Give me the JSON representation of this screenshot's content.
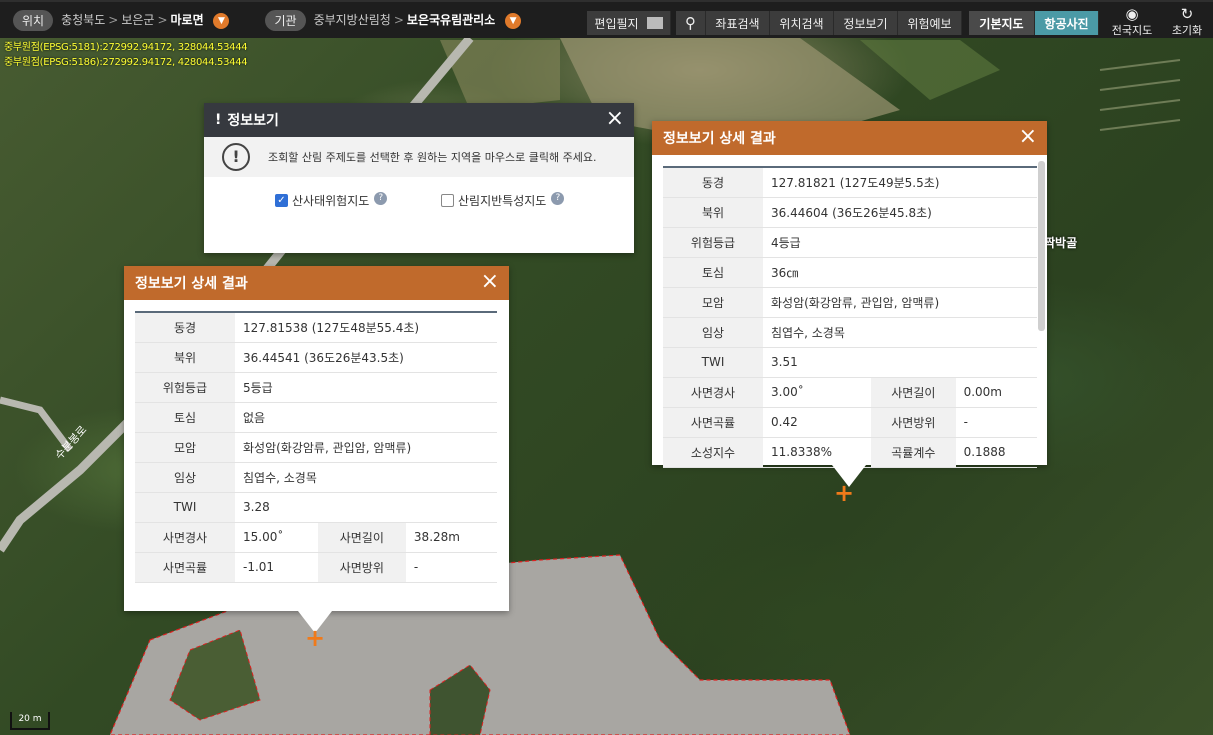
{
  "topbar": {
    "location_label": "위치",
    "location_path": [
      "충청북도",
      "보은군"
    ],
    "location_current": "마로면",
    "agency_label": "기관",
    "agency_path": [
      "중부지방산림청"
    ],
    "agency_current": "보은국유림관리소",
    "edit_parcel": "편입필지",
    "coord_search": "좌표검색",
    "pos_search": "위치검색",
    "info_view": "정보보기",
    "risk_forecast": "위험예보",
    "base_map": "기본지도",
    "aerial": "항공사진",
    "nation_map": "전국지도",
    "reset": "초기화"
  },
  "map": {
    "coord_line1": "중부원점(EPSG:5181):272992.94172, 328044.53444",
    "coord_line2": "중부원점(EPSG:5186):272992.94172, 428044.53444",
    "road_label": "수분봉로",
    "place_label": "짝박골",
    "scale": "20 m"
  },
  "info_panel": {
    "title": "정보보기",
    "message": "조회할 산림 주제도를 선택한 후 원하는 지역을 마우스로 클릭해 주세요.",
    "opt1": "산사태위험지도",
    "opt2": "산림지반특성지도",
    "opt1_checked": true,
    "opt2_checked": false
  },
  "detail_left": {
    "title": "정보보기 상세 결과",
    "rows": [
      {
        "k": "동경",
        "v": "127.81538 (127도48분55.4초)"
      },
      {
        "k": "북위",
        "v": "36.44541 (36도26분43.5초)"
      },
      {
        "k": "위험등급",
        "v": "5등급"
      },
      {
        "k": "토심",
        "v": "없음"
      },
      {
        "k": "모암",
        "v": "화성암(화강암류, 관입암, 암맥류)"
      },
      {
        "k": "임상",
        "v": "침엽수, 소경목"
      },
      {
        "k": "TWI",
        "v": "3.28"
      }
    ],
    "pairs": [
      {
        "k1": "사면경사",
        "v1": "15.00˚",
        "k2": "사면길이",
        "v2": "38.28m"
      },
      {
        "k1": "사면곡률",
        "v1": "-1.01",
        "k2": "사면방위",
        "v2": "-"
      }
    ]
  },
  "detail_right": {
    "title": "정보보기 상세 결과",
    "rows": [
      {
        "k": "동경",
        "v": "127.81821 (127도49분5.5초)"
      },
      {
        "k": "북위",
        "v": "36.44604 (36도26분45.8초)"
      },
      {
        "k": "위험등급",
        "v": "4등급"
      },
      {
        "k": "토심",
        "v": "36㎝"
      },
      {
        "k": "모암",
        "v": "화성암(화강암류, 관입암, 암맥류)"
      },
      {
        "k": "임상",
        "v": "침엽수, 소경목"
      },
      {
        "k": "TWI",
        "v": "3.51"
      }
    ],
    "pairs": [
      {
        "k1": "사면경사",
        "v1": "3.00˚",
        "k2": "사면길이",
        "v2": "0.00m"
      },
      {
        "k1": "사면곡률",
        "v1": "0.42",
        "k2": "사면방위",
        "v2": "-"
      },
      {
        "k1": "소성지수",
        "v1": "11.8338%",
        "k2": "곡률계수",
        "v2": "0.1888"
      }
    ]
  },
  "icons": {
    "close": "×",
    "search": "⚲",
    "eye": "◉",
    "reset": "↻",
    "dropdown": "▼",
    "warning": "!",
    "help": "?",
    "pin": "+"
  },
  "colors": {
    "accent": "#c06a2c",
    "active": "#4b9aa6",
    "dark": "#36393f"
  }
}
